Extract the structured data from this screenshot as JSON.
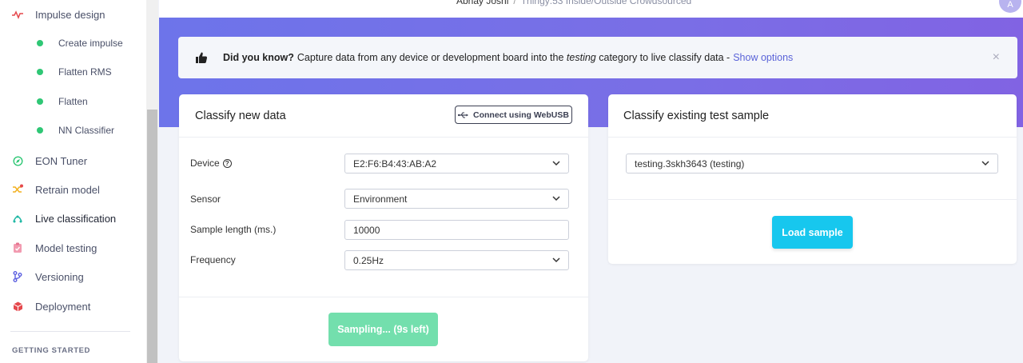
{
  "sidebar": {
    "impulse_design": "Impulse design",
    "sub_items": [
      "Create impulse",
      "Flatten RMS",
      "Flatten",
      "NN Classifier"
    ],
    "items": [
      "EON Tuner",
      "Retrain model",
      "Live classification",
      "Model testing",
      "Versioning",
      "Deployment"
    ],
    "section_label": "GETTING STARTED"
  },
  "header": {
    "user": "Abhay Joshi",
    "separator": "/",
    "project": "Thingy:53 Inside/Outside Crowdsourced",
    "avatar_initial": "A"
  },
  "banner": {
    "strong": "Did you know?",
    "text_before": "Capture data from any device or development board into the",
    "text_em": "testing",
    "text_after": "category to live classify data -",
    "link": "Show options",
    "close": "×"
  },
  "classify_new": {
    "title": "Classify new data",
    "usb_button": "Connect using WebUSB",
    "device_label": "Device",
    "device_value": "E2:F6:B4:43:AB:A2",
    "sensor_label": "Sensor",
    "sensor_value": "Environment",
    "sample_length_label": "Sample length (ms.)",
    "sample_length_value": "10000",
    "frequency_label": "Frequency",
    "frequency_value": "0.25Hz",
    "sampling_button": "Sampling... (9s left)"
  },
  "classify_existing": {
    "title": "Classify existing test sample",
    "sample_value": "testing.3skh3643 (testing)",
    "load_button": "Load sample"
  },
  "colors": {
    "accent_purple": "#6d74ea",
    "green_dot": "#2fc775",
    "sampling_green": "#73dfad",
    "load_cyan": "#17c7ee"
  }
}
